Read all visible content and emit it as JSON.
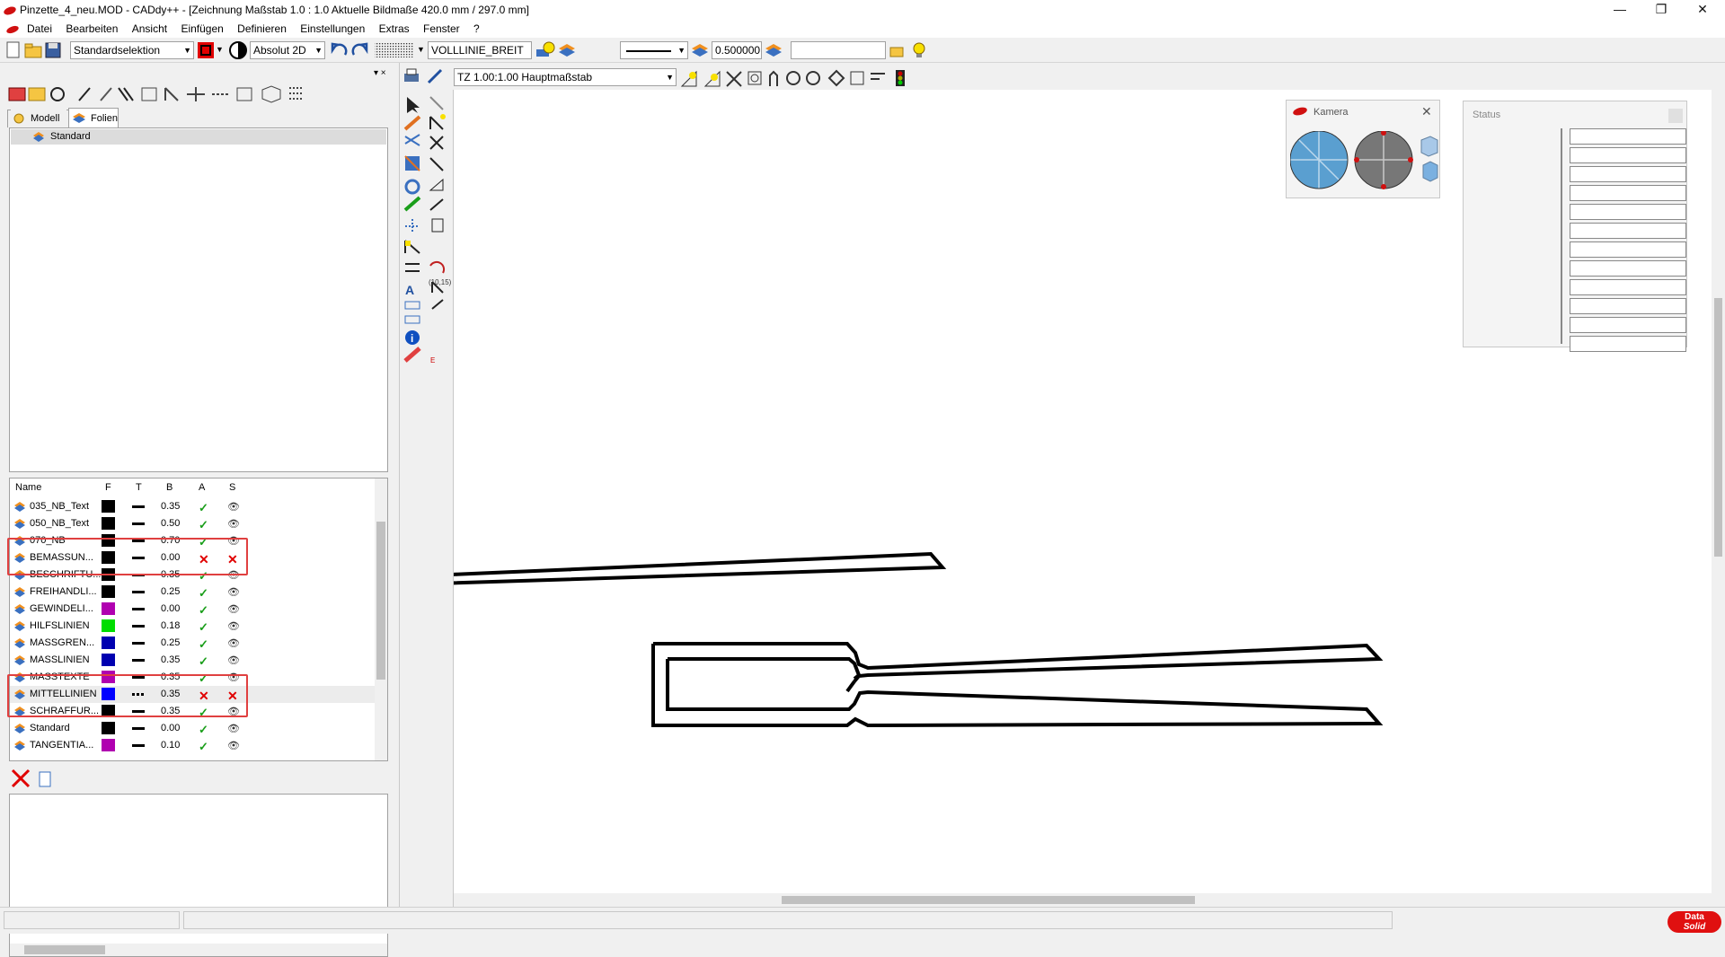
{
  "window": {
    "title": "Pinzette_4_neu.MOD  -  CADdy++ - [Zeichnung    Maßstab 1.0 : 1.0   Aktuelle Bildmaße 420.0 mm / 297.0 mm]",
    "minimize": "—",
    "restore": "❐",
    "close": "✕"
  },
  "menu": [
    "Datei",
    "Bearbeiten",
    "Ansicht",
    "Einfügen",
    "Definieren",
    "Einstellungen",
    "Extras",
    "Fenster",
    "?"
  ],
  "toolbar": {
    "selection_mode": "Standardselektion",
    "coord_mode": "Absolut 2D",
    "linetype": "VOLLLINIE_BREIT",
    "line_width": "0.500000",
    "free_field": ""
  },
  "view_toolbar": {
    "scale_combo": "TZ 1.00:1.00 Hauptmaßstab"
  },
  "tabs": {
    "model": "Modell",
    "layers": "Folien"
  },
  "tree": {
    "root": "Standard"
  },
  "layers": {
    "headers": {
      "name": "Name",
      "f": "F",
      "t": "T",
      "b": "B",
      "a": "A",
      "s": "S"
    },
    "rows": [
      {
        "name": "035_NB_Text",
        "color": "#000000",
        "width": "0.35",
        "active": true,
        "visible": true
      },
      {
        "name": "050_NB_Text",
        "color": "#000000",
        "width": "0.50",
        "active": true,
        "visible": true
      },
      {
        "name": "070_NB",
        "color": "#000000",
        "width": "0.70",
        "active": true,
        "visible": true
      },
      {
        "name": "BEMASSUN...",
        "color": "#000000",
        "width": "0.00",
        "active": false,
        "visible": false
      },
      {
        "name": "BESCHRIFTU...",
        "color": "#000000",
        "width": "0.35",
        "active": true,
        "visible": true
      },
      {
        "name": "FREIHANDLI...",
        "color": "#000000",
        "width": "0.25",
        "active": true,
        "visible": true
      },
      {
        "name": "GEWINDELI...",
        "color": "#b000b0",
        "width": "0.00",
        "active": true,
        "visible": true
      },
      {
        "name": "HILFSLINIEN",
        "color": "#00dd00",
        "width": "0.18",
        "active": true,
        "visible": true
      },
      {
        "name": "MASSGREN...",
        "color": "#0000b0",
        "width": "0.25",
        "active": true,
        "visible": true
      },
      {
        "name": "MASSLINIEN",
        "color": "#0000b0",
        "width": "0.35",
        "active": true,
        "visible": true
      },
      {
        "name": "MASSTEXTE",
        "color": "#b000b0",
        "width": "0.35",
        "active": true,
        "visible": true
      },
      {
        "name": "MITTELLINIEN",
        "color": "#0000ff",
        "width": "0.35",
        "active": false,
        "visible": false
      },
      {
        "name": "SCHRAFFUR...",
        "color": "#000000",
        "width": "0.35",
        "active": true,
        "visible": true
      },
      {
        "name": "Standard",
        "color": "#000000",
        "width": "0.00",
        "active": true,
        "visible": true
      },
      {
        "name": "TANGENTIA...",
        "color": "#b000b0",
        "width": "0.10",
        "active": true,
        "visible": true
      }
    ]
  },
  "camera": {
    "title": "Kamera"
  },
  "status": {
    "title": "Status"
  },
  "coord_label": "(10,15)",
  "brand": {
    "line1": "Data",
    "line2": "Solid"
  },
  "colors": {
    "highlight": "#e04040",
    "canvas": "#ffffff"
  }
}
